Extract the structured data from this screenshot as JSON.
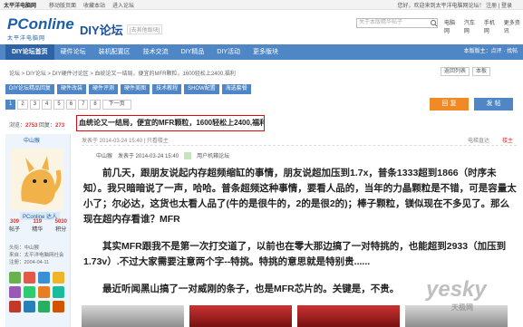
{
  "topbar": {
    "brand": "太平洋电脑网",
    "links": [
      "移动版页面",
      "收藏本站",
      "进入论坛"
    ],
    "right_text": "您好，欢迎来到太平洋电脑网论坛！ 注册 | 登录"
  },
  "header": {
    "logo_main": "PConline",
    "logo_cn": "太平洋电脑网",
    "site_title": "DIY论坛",
    "site_tag": "[去其他版块]",
    "search_placeholder": "关于本版精华帖子",
    "nav_links": [
      "电脑网",
      "汽车网",
      "手机网",
      "更多资讯"
    ]
  },
  "mainnav": {
    "items": [
      "DIY论坛首页",
      "硬件论坛",
      "装机配置区",
      "技术交流",
      "DIY精品",
      "DIY活动",
      "更多版块"
    ],
    "right": "本版版主：点评 · 找帖"
  },
  "breadcrumb": "论坛 > DIY论坛 > DIY硬件讨论区 > 血统论又一结局，便宜的MFR颗粒，1600轻松上2400,福利",
  "crumb_right": [
    "返回列表",
    "本板"
  ],
  "tools": [
    "DIY论坛精品回复",
    "硬件改装",
    "硬件评测",
    "硬件美图",
    "技术教程",
    "SHOW配置",
    "海选套餐"
  ],
  "pager": {
    "pages": [
      "1",
      "2",
      "3",
      "4",
      "5",
      "6",
      "7",
      "8"
    ],
    "next": "下一页"
  },
  "actions": {
    "reply": "回 复",
    "post": "发 帖"
  },
  "stats": {
    "label_views": "浏览：",
    "views": "2753",
    "label_replies": " 回复：",
    "replies": "273"
  },
  "thread_title": "血统论又一结局，便宜的MFR颗粒，1600轻松上2400,福利",
  "user": {
    "name": "中山猴",
    "rank": "PConline 达人",
    "stats": [
      {
        "v": "309",
        "l": "帖子"
      },
      {
        "v": "119",
        "l": "精华"
      },
      {
        "v": "5030",
        "l": "积分"
      }
    ],
    "info": [
      "头衔：中山猴",
      "来自：太平洋电脑网社会",
      "注册：2004-04-11"
    ]
  },
  "postinfo": {
    "text": "发表于 2014-03-24 15:40 | 只看楼主",
    "right": "电梯直达",
    "floor": "楼主"
  },
  "authorrow": {
    "name": "中山猴",
    "date": "发表于 2014-03-24 15:40",
    "group": "用户机箱论坛"
  },
  "body": [
    "前几天，跟朋友说起内存超频缩缸的事情，朋友说超加压到1.7x，普条1333超到1866（时序未知）。我只暗暗说了一声，哈哈。普条超频这种事情，要看人品的，当年的力晶颗粒是不错，可是容量太小了；尔必达，这货也太看人品了(牛的是很牛的，2的是很2的)；棒子颗粒，镁似现在不多见了。那么现在超内存看谁？MFR",
    "其实MFR跟我不是第一次打交道了，以前也在零大那边搞了一对特挑的，也能超到2933（加压到1.73v）.不过大家需要注意两个字--特挑。特挑的意思就是特别贵......",
    "最近听闻黑山搞了一对威刚的条子，也是MFR芯片的。关键是，不贵。"
  ],
  "watermark": {
    "main": "yesky",
    "sub": "天极网"
  }
}
